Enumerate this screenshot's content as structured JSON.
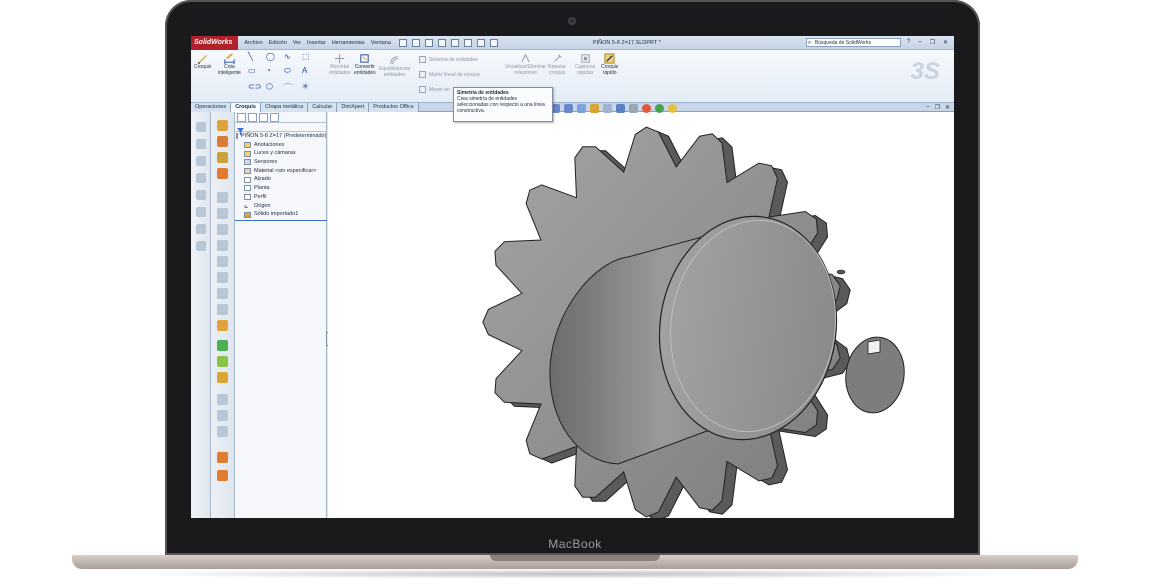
{
  "app": {
    "logo": "SolidWorks",
    "document_title": "PIÑON 5-8 Z=17.SLDPRT *",
    "search_placeholder": "Búsqueda de SolidWorks"
  },
  "menu": [
    "Archivo",
    "Edición",
    "Ver",
    "Insertar",
    "Herramientas",
    "Ventana"
  ],
  "ribbon": {
    "croquis": "Croquis",
    "cota_inteligente_1": "Cota",
    "cota_inteligente_2": "inteligente",
    "recortar_1": "Recortar",
    "recortar_2": "entidades",
    "convertir_1": "Convertir",
    "convertir_2": "entidades",
    "equidistanciar_1": "Equidistanciar",
    "equidistanciar_2": "entidades",
    "simetria": "Simetría de entidades",
    "matriz_lineal": "Matriz lineal de croquis",
    "mover": "Mover en",
    "visualizar_1": "Visualizar/Eliminar",
    "visualizar_2": "relaciones",
    "reparar_1": "Reparar",
    "reparar_2": "croquis",
    "capturas_1": "Capturas",
    "capturas_2": "rápidas",
    "croquis_rapido_1": "Croquis",
    "croquis_rapido_2": "rápido"
  },
  "tabs": [
    "Operaciones",
    "Croquis",
    "Chapa metálica",
    "Calcular",
    "DimXpert",
    "Productos Office"
  ],
  "tooltip": {
    "title": "Simetría de entidades",
    "body": "Crea simetría de entidades seleccionadas con respecto a una línea constructiva."
  },
  "tree": {
    "root": "PIÑON 5-8 Z=17 (Predeterminado)",
    "items": [
      "Anotaciones",
      "Luces y cámaras",
      "Sensores",
      "Material <sin especificar>",
      "Alzado",
      "Planta",
      "Perfil",
      "Origen",
      "Sólido importado1"
    ]
  },
  "laptop_label": "MacBook",
  "colors": {
    "brand": "#b2202a",
    "chrome": "#dfe6ef",
    "active_tab": "#f6f9fd",
    "part_face": "#8f8f8f"
  }
}
